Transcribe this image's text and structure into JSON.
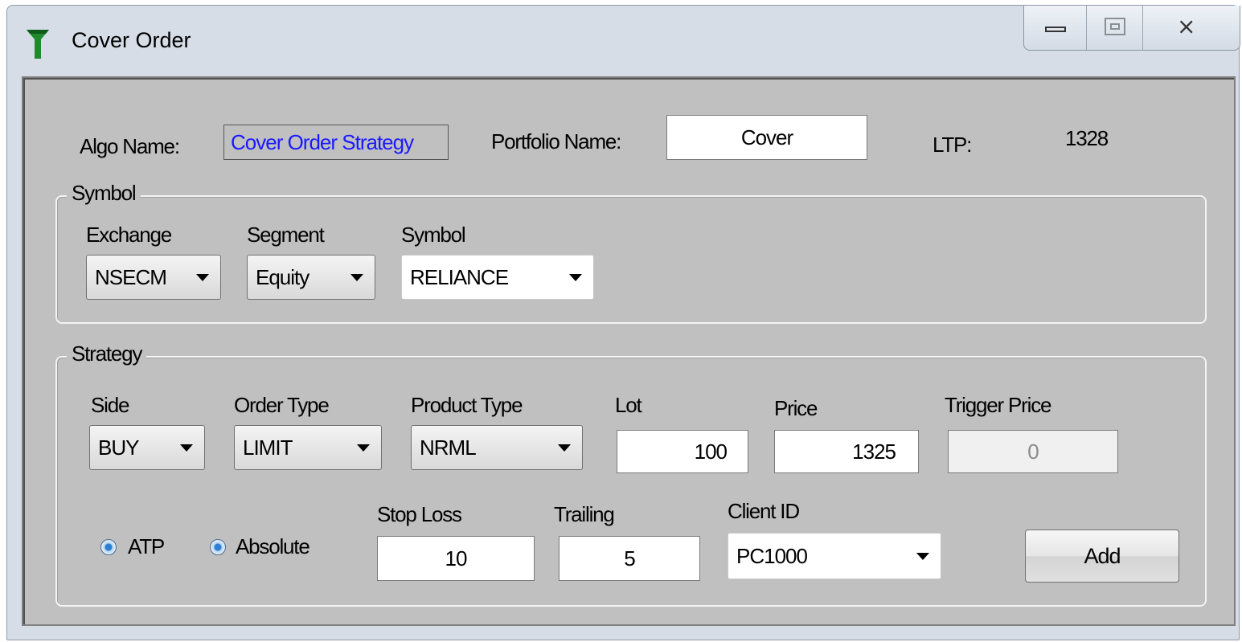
{
  "window": {
    "title": "Cover Order",
    "minimize_icon": "minimize-icon",
    "maximize_icon": "maximize-icon",
    "close_icon": "close-icon",
    "app_icon": "funnel-icon",
    "app_icon_color": "#1e8a2c"
  },
  "header": {
    "algo_label": "Algo Name:",
    "algo_value": "Cover Order Strategy",
    "portfolio_label": "Portfolio Name:",
    "portfolio_value": "Cover",
    "ltp_label": "LTP:",
    "ltp_value": "1328"
  },
  "symbol_group": {
    "legend": "Symbol",
    "exchange_label": "Exchange",
    "exchange_value": "NSECM",
    "segment_label": "Segment",
    "segment_value": "Equity",
    "symbol_label": "Symbol",
    "symbol_value": "RELIANCE"
  },
  "strategy_group": {
    "legend": "Strategy",
    "side_label": "Side",
    "side_value": "BUY",
    "order_type_label": "Order Type",
    "order_type_value": "LIMIT",
    "product_type_label": "Product Type",
    "product_type_value": "NRML",
    "lot_label": "Lot",
    "lot_value": "100",
    "price_label": "Price",
    "price_value": "1325",
    "trigger_label": "Trigger Price",
    "trigger_value": "0",
    "atp_label": "ATP",
    "absolute_label": "Absolute",
    "stop_loss_label": "Stop Loss",
    "stop_loss_value": "10",
    "trailing_label": "Trailing",
    "trailing_value": "5",
    "client_id_label": "Client ID",
    "client_id_value": "PC1000",
    "add_button": "Add"
  }
}
